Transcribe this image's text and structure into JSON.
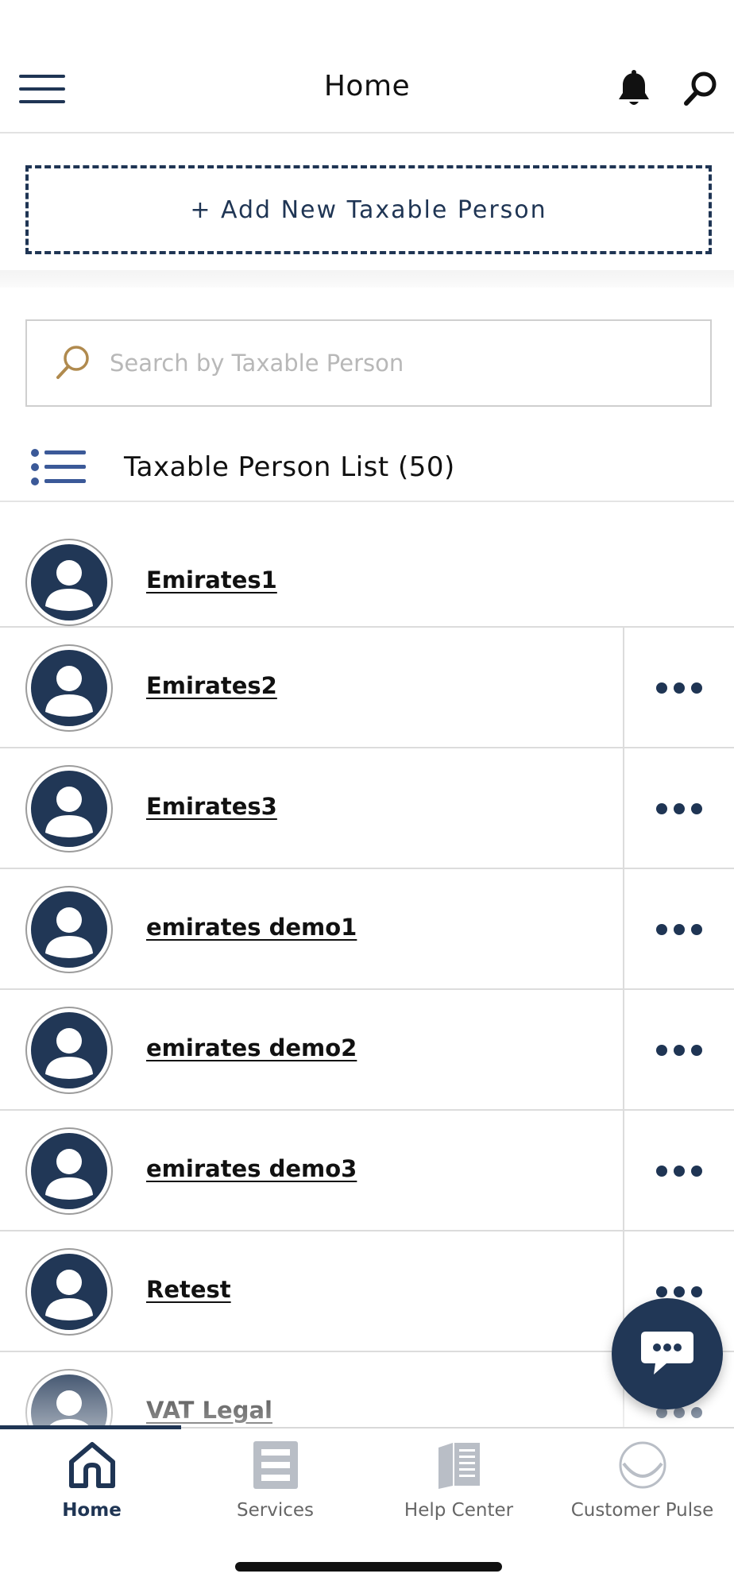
{
  "header": {
    "title": "Home",
    "menu_icon": "hamburger-menu-icon",
    "bell_icon": "bell-icon",
    "search_icon": "search-icon"
  },
  "add_button": {
    "label": "+ Add New Taxable Person"
  },
  "search": {
    "placeholder": "Search by Taxable Person",
    "value": ""
  },
  "list": {
    "title": "Taxable Person List (50)",
    "items": [
      {
        "name": "Emirates1",
        "has_more": false
      },
      {
        "name": "Emirates2",
        "has_more": true
      },
      {
        "name": "Emirates3",
        "has_more": true
      },
      {
        "name": "emirates demo1",
        "has_more": true
      },
      {
        "name": "emirates demo2",
        "has_more": true
      },
      {
        "name": "emirates demo3",
        "has_more": true
      },
      {
        "name": "Retest",
        "has_more": true
      },
      {
        "name": "VAT Legal",
        "has_more": true
      }
    ]
  },
  "tabs": [
    {
      "label": "Home",
      "icon": "home-icon",
      "active": true
    },
    {
      "label": "Services",
      "icon": "services-icon",
      "active": false
    },
    {
      "label": "Help Center",
      "icon": "book-icon",
      "active": false
    },
    {
      "label": "Customer Pulse",
      "icon": "smile-icon",
      "active": false
    }
  ],
  "colors": {
    "primary": "#1f3554",
    "accent_gold": "#b08a4e",
    "divider": "#dcdcdc"
  }
}
